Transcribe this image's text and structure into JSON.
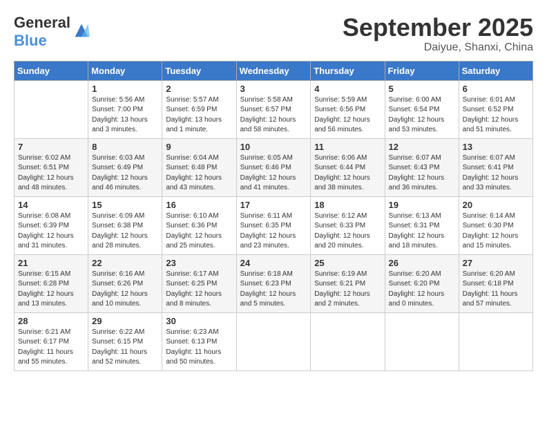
{
  "header": {
    "logo_general": "General",
    "logo_blue": "Blue",
    "month_title": "September 2025",
    "location": "Daiyue, Shanxi, China"
  },
  "weekdays": [
    "Sunday",
    "Monday",
    "Tuesday",
    "Wednesday",
    "Thursday",
    "Friday",
    "Saturday"
  ],
  "weeks": [
    [
      {
        "day": "",
        "info": ""
      },
      {
        "day": "1",
        "info": "Sunrise: 5:56 AM\nSunset: 7:00 PM\nDaylight: 13 hours\nand 3 minutes."
      },
      {
        "day": "2",
        "info": "Sunrise: 5:57 AM\nSunset: 6:59 PM\nDaylight: 13 hours\nand 1 minute."
      },
      {
        "day": "3",
        "info": "Sunrise: 5:58 AM\nSunset: 6:57 PM\nDaylight: 12 hours\nand 58 minutes."
      },
      {
        "day": "4",
        "info": "Sunrise: 5:59 AM\nSunset: 6:56 PM\nDaylight: 12 hours\nand 56 minutes."
      },
      {
        "day": "5",
        "info": "Sunrise: 6:00 AM\nSunset: 6:54 PM\nDaylight: 12 hours\nand 53 minutes."
      },
      {
        "day": "6",
        "info": "Sunrise: 6:01 AM\nSunset: 6:52 PM\nDaylight: 12 hours\nand 51 minutes."
      }
    ],
    [
      {
        "day": "7",
        "info": "Sunrise: 6:02 AM\nSunset: 6:51 PM\nDaylight: 12 hours\nand 48 minutes."
      },
      {
        "day": "8",
        "info": "Sunrise: 6:03 AM\nSunset: 6:49 PM\nDaylight: 12 hours\nand 46 minutes."
      },
      {
        "day": "9",
        "info": "Sunrise: 6:04 AM\nSunset: 6:48 PM\nDaylight: 12 hours\nand 43 minutes."
      },
      {
        "day": "10",
        "info": "Sunrise: 6:05 AM\nSunset: 6:46 PM\nDaylight: 12 hours\nand 41 minutes."
      },
      {
        "day": "11",
        "info": "Sunrise: 6:06 AM\nSunset: 6:44 PM\nDaylight: 12 hours\nand 38 minutes."
      },
      {
        "day": "12",
        "info": "Sunrise: 6:07 AM\nSunset: 6:43 PM\nDaylight: 12 hours\nand 36 minutes."
      },
      {
        "day": "13",
        "info": "Sunrise: 6:07 AM\nSunset: 6:41 PM\nDaylight: 12 hours\nand 33 minutes."
      }
    ],
    [
      {
        "day": "14",
        "info": "Sunrise: 6:08 AM\nSunset: 6:39 PM\nDaylight: 12 hours\nand 31 minutes."
      },
      {
        "day": "15",
        "info": "Sunrise: 6:09 AM\nSunset: 6:38 PM\nDaylight: 12 hours\nand 28 minutes."
      },
      {
        "day": "16",
        "info": "Sunrise: 6:10 AM\nSunset: 6:36 PM\nDaylight: 12 hours\nand 25 minutes."
      },
      {
        "day": "17",
        "info": "Sunrise: 6:11 AM\nSunset: 6:35 PM\nDaylight: 12 hours\nand 23 minutes."
      },
      {
        "day": "18",
        "info": "Sunrise: 6:12 AM\nSunset: 6:33 PM\nDaylight: 12 hours\nand 20 minutes."
      },
      {
        "day": "19",
        "info": "Sunrise: 6:13 AM\nSunset: 6:31 PM\nDaylight: 12 hours\nand 18 minutes."
      },
      {
        "day": "20",
        "info": "Sunrise: 6:14 AM\nSunset: 6:30 PM\nDaylight: 12 hours\nand 15 minutes."
      }
    ],
    [
      {
        "day": "21",
        "info": "Sunrise: 6:15 AM\nSunset: 6:28 PM\nDaylight: 12 hours\nand 13 minutes."
      },
      {
        "day": "22",
        "info": "Sunrise: 6:16 AM\nSunset: 6:26 PM\nDaylight: 12 hours\nand 10 minutes."
      },
      {
        "day": "23",
        "info": "Sunrise: 6:17 AM\nSunset: 6:25 PM\nDaylight: 12 hours\nand 8 minutes."
      },
      {
        "day": "24",
        "info": "Sunrise: 6:18 AM\nSunset: 6:23 PM\nDaylight: 12 hours\nand 5 minutes."
      },
      {
        "day": "25",
        "info": "Sunrise: 6:19 AM\nSunset: 6:21 PM\nDaylight: 12 hours\nand 2 minutes."
      },
      {
        "day": "26",
        "info": "Sunrise: 6:20 AM\nSunset: 6:20 PM\nDaylight: 12 hours\nand 0 minutes."
      },
      {
        "day": "27",
        "info": "Sunrise: 6:20 AM\nSunset: 6:18 PM\nDaylight: 11 hours\nand 57 minutes."
      }
    ],
    [
      {
        "day": "28",
        "info": "Sunrise: 6:21 AM\nSunset: 6:17 PM\nDaylight: 11 hours\nand 55 minutes."
      },
      {
        "day": "29",
        "info": "Sunrise: 6:22 AM\nSunset: 6:15 PM\nDaylight: 11 hours\nand 52 minutes."
      },
      {
        "day": "30",
        "info": "Sunrise: 6:23 AM\nSunset: 6:13 PM\nDaylight: 11 hours\nand 50 minutes."
      },
      {
        "day": "",
        "info": ""
      },
      {
        "day": "",
        "info": ""
      },
      {
        "day": "",
        "info": ""
      },
      {
        "day": "",
        "info": ""
      }
    ]
  ]
}
